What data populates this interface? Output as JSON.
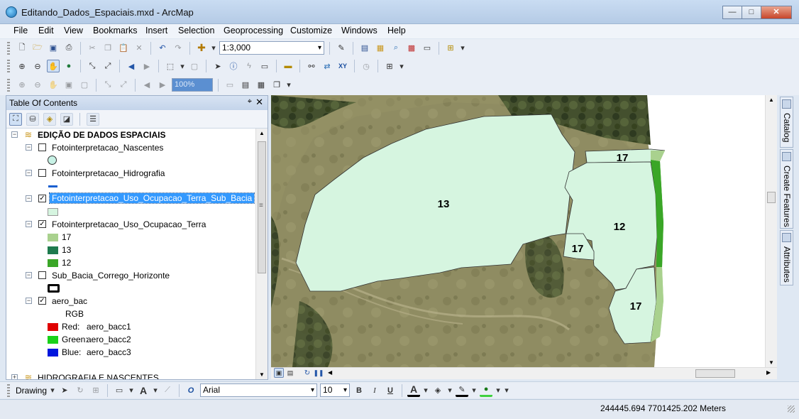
{
  "window": {
    "title": "Editando_Dados_Espaciais.mxd - ArcMap",
    "minimize_glyph": "—",
    "maximize_glyph": "□",
    "close_glyph": "✕"
  },
  "menu": [
    "File",
    "Edit",
    "View",
    "Bookmarks",
    "Insert",
    "Selection",
    "Geoprocessing",
    "Customize",
    "Windows",
    "Help"
  ],
  "standard_toolbar": {
    "scale": "1:3,000"
  },
  "georef_toolbar": {
    "percent": "100%"
  },
  "toc": {
    "title": "Table Of Contents",
    "pin_glyph": "⌖",
    "close_glyph": "✕",
    "group1": "EDIÇÃO DE DADOS ESPACIAIS",
    "layers": {
      "nascentes": "Fotointerpretacao_Nascentes",
      "hidrografia": "Fotointerpretacao_Hidrografia",
      "uso_sub_bacia": "Fotointerpretacao_Uso_Ocupacao_Terra_Sub_Bacia",
      "uso": "Fotointerpretacao_Uso_Ocupacao_Terra",
      "sub_bacia": "Sub_Bacia_Corrego_Horizonte",
      "aero": "aero_bac"
    },
    "uso_classes": [
      {
        "label": "17",
        "color": "#a9d18e"
      },
      {
        "label": "13",
        "color": "#1e7b4e"
      },
      {
        "label": "12",
        "color": "#3aa627"
      }
    ],
    "rgb_label": "RGB",
    "bands": [
      {
        "label": "Red:",
        "value": "aero_bacc1",
        "color": "#e00000"
      },
      {
        "label": "Green:",
        "value": "aero_bacc2",
        "color": "#19d119"
      },
      {
        "label": "Blue:",
        "value": "aero_bacc3",
        "color": "#0016dd"
      }
    ],
    "group2": "HIDROGRAFIA E NASCENTES"
  },
  "map": {
    "polygon_fill": "#d6f5e0",
    "labels": [
      "13",
      "17",
      "12",
      "17",
      "17"
    ]
  },
  "dock_tabs": [
    "Catalog",
    "Create Features",
    "Attributes"
  ],
  "drawing_toolbar": {
    "label": "Drawing",
    "font": "Arial",
    "size": "10",
    "bold": "B",
    "italic": "I",
    "underline": "U",
    "font_color_glyph": "A"
  },
  "status": {
    "coordinates": "244445.694  7701425.202 Meters"
  }
}
